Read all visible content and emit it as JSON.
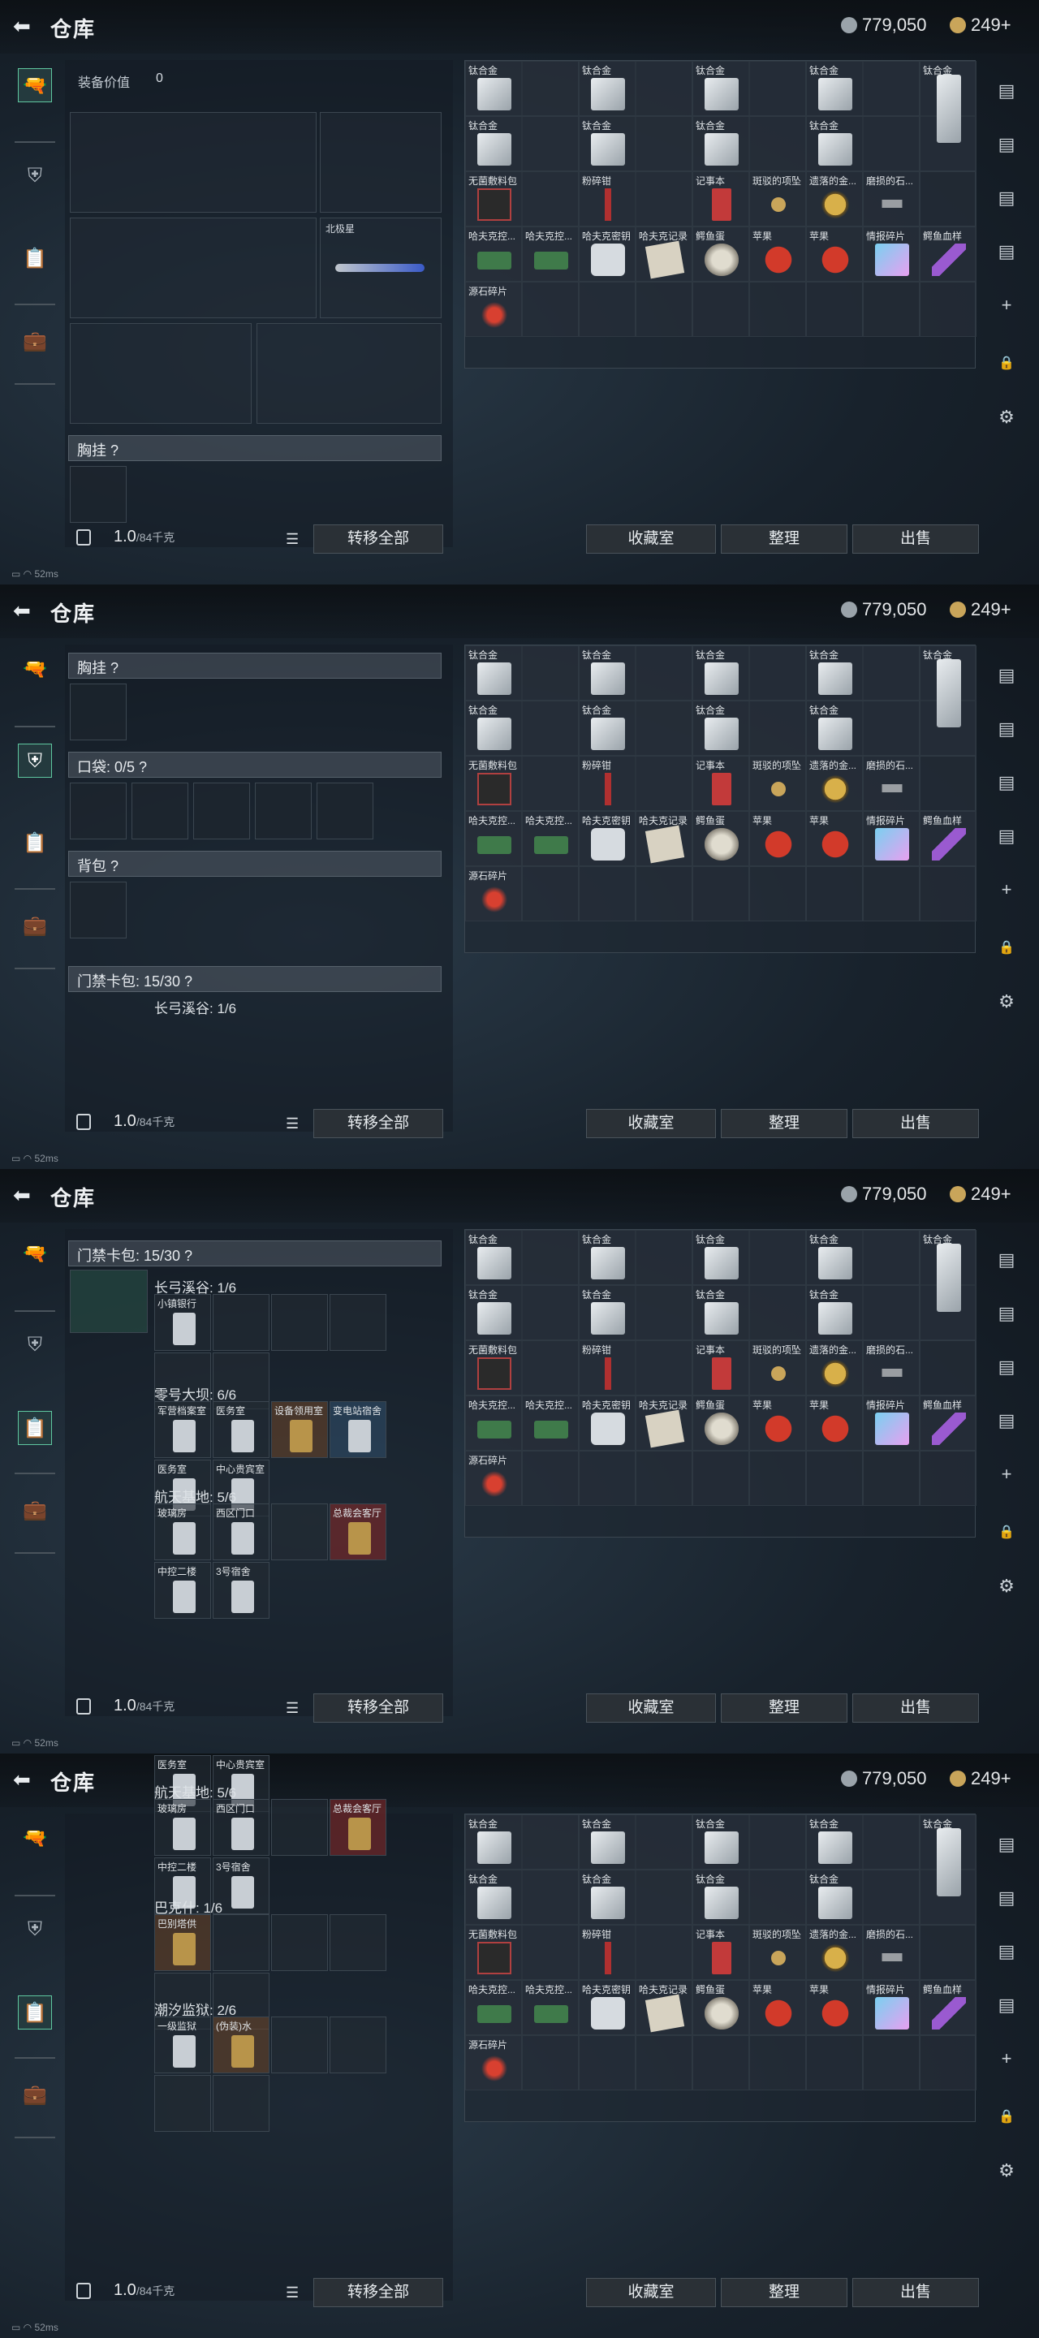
{
  "header": {
    "back_icon": "back-arrow-icon",
    "title": "仓库",
    "silver": "779,050",
    "gold": "249+"
  },
  "equip": {
    "value_label": "装备价值",
    "value": "0",
    "melee_name": "北极星"
  },
  "sections": {
    "chest": "胸挂 ?",
    "pocket": "口袋: 0/5 ?",
    "backpack": "背包 ?",
    "keycard": "门禁卡包: 15/30 ?"
  },
  "keyzones": [
    {
      "name": "长弓溪谷: 1/6",
      "items": [
        "小镇银行"
      ]
    },
    {
      "name": "零号大坝: 6/6",
      "items": [
        "军营档案室",
        "医务室",
        "设备领用室",
        "变电站宿舍",
        "医务室",
        "中心贵宾室"
      ]
    },
    {
      "name": "航天基地: 5/6",
      "items": [
        "玻璃房",
        "西区门口",
        "",
        "总裁会客厅",
        "中控二楼",
        "3号宿舍"
      ]
    },
    {
      "name": "巴克什: 1/6",
      "items": [
        "巴别塔供"
      ]
    },
    {
      "name": "潮汐监狱: 2/6",
      "items": [
        "一级监狱",
        "(伪装)水"
      ]
    }
  ],
  "bottom": {
    "weight": "1.0",
    "weight_max": "/84千克",
    "transfer_all": "转移全部",
    "collection": "收藏室",
    "sort": "整理",
    "sell": "出售"
  },
  "storage": [
    {
      "name": "钛合金",
      "kind": "plate"
    },
    {
      "name": "钛合金",
      "kind": "plate"
    },
    {
      "name": "钛合金",
      "kind": "plate"
    },
    {
      "name": "钛合金",
      "kind": "plate"
    },
    {
      "name": "钛合金",
      "kind": "plate-tall"
    },
    {
      "name": "钛合金",
      "kind": "plate"
    },
    {
      "name": "钛合金",
      "kind": "plate"
    },
    {
      "name": "钛合金",
      "kind": "plate"
    },
    {
      "name": "钛合金",
      "kind": "plate"
    },
    {
      "name": "无菌敷料包",
      "kind": "pack"
    },
    {
      "name": "粉碎钳",
      "kind": "tool"
    },
    {
      "name": "记事本",
      "kind": "book"
    },
    {
      "name": "斑驳的项坠",
      "kind": "pendant"
    },
    {
      "name": "遗落的金...",
      "kind": "gold"
    },
    {
      "name": "磨损的石...",
      "kind": "stone"
    },
    {
      "name": "哈夫克控...",
      "kind": "chip"
    },
    {
      "name": "哈夫克控...",
      "kind": "chip"
    },
    {
      "name": "哈夫克密钥",
      "kind": "whistle"
    },
    {
      "name": "哈夫克记录",
      "kind": "paper"
    },
    {
      "name": "鳄鱼蛋",
      "kind": "egg"
    },
    {
      "name": "苹果",
      "kind": "apple"
    },
    {
      "name": "苹果",
      "kind": "apple"
    },
    {
      "name": "情报碎片",
      "kind": "card"
    },
    {
      "name": "鳄鱼血样",
      "kind": "vial"
    },
    {
      "name": "源石碎片",
      "kind": "shard"
    }
  ],
  "side": {
    "status_ping": "52ms"
  }
}
